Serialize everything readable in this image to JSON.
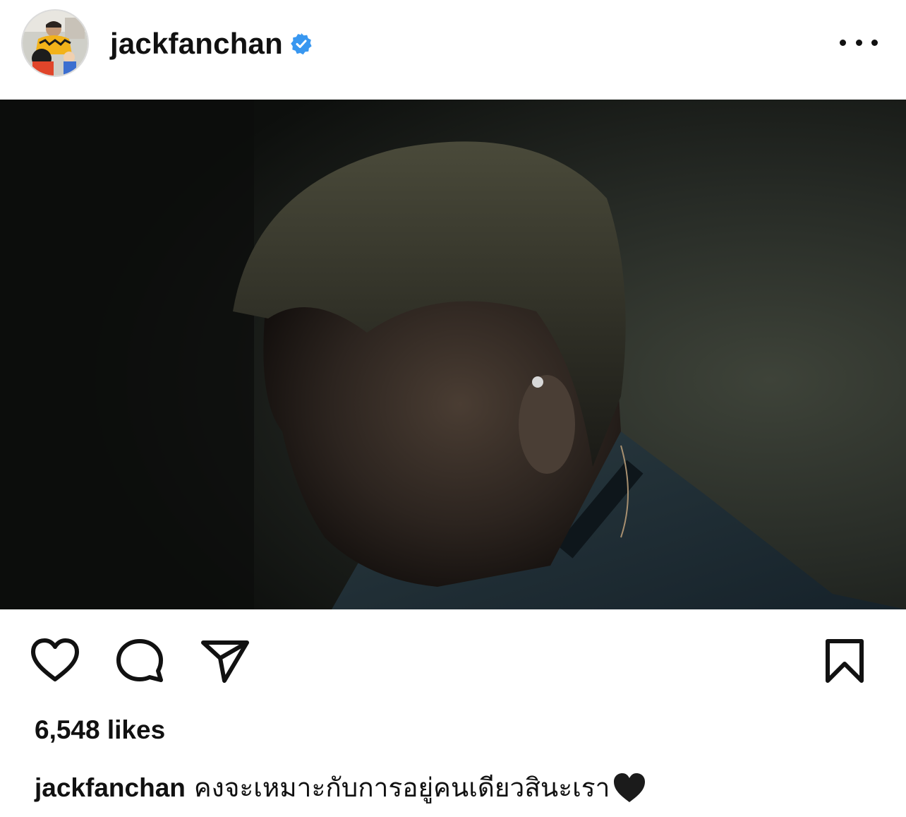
{
  "post": {
    "username": "jackfanchan",
    "verified": true,
    "likes_text": "6,548 likes",
    "caption": {
      "username": "jackfanchan",
      "text": "คงจะเหมาะกับการอยู่คนเดียวสินะเรา",
      "emoji": "black-heart-icon"
    }
  },
  "icons": {
    "verified": "verified-badge-icon",
    "more": "more-options-icon",
    "like": "heart-outline-icon",
    "comment": "comment-bubble-icon",
    "share": "paper-plane-icon",
    "save": "bookmark-outline-icon"
  },
  "colors": {
    "verified_blue": "#3897f0",
    "text": "#111111",
    "background": "#ffffff"
  }
}
